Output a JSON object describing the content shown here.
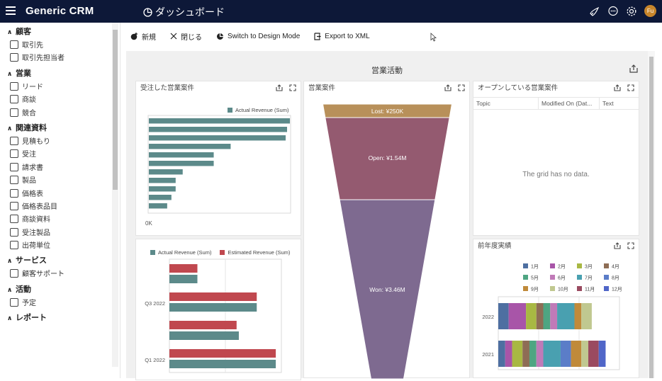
{
  "app": {
    "name": "Generic CRM",
    "page_title": "ダッシュボード",
    "avatar_initials": "Fu"
  },
  "sidebar": {
    "groups": [
      {
        "label": "顧客",
        "items": [
          "取引先",
          "取引先担当者"
        ]
      },
      {
        "label": "営業",
        "items": [
          "リード",
          "商談",
          "競合"
        ]
      },
      {
        "label": "関連資料",
        "items": [
          "見積もり",
          "受注",
          "請求書",
          "製品",
          "価格表",
          "価格表品目",
          "商談資料",
          "受注製品",
          "出荷単位"
        ]
      },
      {
        "label": "サービス",
        "items": [
          "顧客サポート"
        ]
      },
      {
        "label": "活動",
        "items": [
          "予定"
        ]
      },
      {
        "label": "レポート",
        "items": []
      }
    ]
  },
  "toolbar": {
    "new": "新規",
    "close": "閉じる",
    "design": "Switch to Design Mode",
    "export": "Export to XML"
  },
  "dashboard": {
    "title": "営業活動",
    "won_panel": {
      "title": "受注した営業案件",
      "legend": "Actual Revenue (Sum)",
      "axis_label": "0K"
    },
    "quarter_panel": {
      "legend_actual": "Actual Revenue (Sum)",
      "legend_estimated": "Estimated Revenue (Sum)",
      "tick_labels": [
        "Q3 2022",
        "Q1 2022"
      ]
    },
    "funnel_panel": {
      "title": "営業案件"
    },
    "open_panel": {
      "title": "オープンしている営業案件",
      "columns": [
        "Topic",
        "Modified On (Dat...",
        "Text"
      ],
      "empty_text": "The grid has no data."
    },
    "yearly_panel": {
      "title": "前年度実績"
    }
  },
  "colors": {
    "teal": "#5c8a8a",
    "red": "#c0484f",
    "funnel_lost": "#b8905a",
    "funnel_open": "#945a70",
    "funnel_won": "#7e6a90"
  },
  "chart_data": [
    {
      "type": "bar",
      "orientation": "horizontal",
      "title": "受注した営業案件",
      "series": [
        {
          "name": "Actual Revenue (Sum)",
          "values": [
            100,
            98,
            97,
            58,
            46,
            46,
            24,
            19,
            19,
            16,
            13
          ]
        }
      ],
      "xlim": [
        0,
        100
      ]
    },
    {
      "type": "bar",
      "orientation": "horizontal",
      "categories": [
        "",
        "Q3 2022",
        "",
        "Q1 2022"
      ],
      "series": [
        {
          "name": "Estimated Revenue (Sum)",
          "values": [
            25,
            78,
            60,
            95
          ]
        },
        {
          "name": "Actual Revenue (Sum)",
          "values": [
            25,
            78,
            62,
            95
          ]
        }
      ],
      "xlim": [
        0,
        100
      ]
    },
    {
      "type": "funnel",
      "title": "営業案件",
      "stages": [
        {
          "label": "Lost: ¥250K",
          "value": 250
        },
        {
          "label": "Open: ¥1.54M",
          "value": 1540
        },
        {
          "label": "Won: ¥3.46M",
          "value": 3460
        }
      ]
    },
    {
      "type": "bar",
      "orientation": "horizontal",
      "stacked": true,
      "title": "前年度実績",
      "categories": [
        "2022",
        "2021"
      ],
      "series": [
        {
          "name": "1月",
          "color": "#4e6fa1",
          "values": [
            3,
            2
          ]
        },
        {
          "name": "2月",
          "color": "#a855a8",
          "values": [
            5,
            2
          ]
        },
        {
          "name": "3月",
          "color": "#a8b843",
          "values": [
            3,
            3
          ]
        },
        {
          "name": "4月",
          "color": "#8e6d55",
          "values": [
            2,
            2
          ]
        },
        {
          "name": "5月",
          "color": "#4ea582",
          "values": [
            2,
            2
          ]
        },
        {
          "name": "6月",
          "color": "#c07ab8",
          "values": [
            2,
            2
          ]
        },
        {
          "name": "7月",
          "color": "#49a0b0",
          "values": [
            5,
            5
          ]
        },
        {
          "name": "8月",
          "color": "#5b7dc8",
          "values": [
            0,
            3
          ]
        },
        {
          "name": "9月",
          "color": "#c08a3a",
          "values": [
            2,
            3
          ]
        },
        {
          "name": "10月",
          "color": "#c0c890",
          "values": [
            3,
            2
          ]
        },
        {
          "name": "11月",
          "color": "#9a4a60",
          "values": [
            0,
            3
          ]
        },
        {
          "name": "12月",
          "color": "#5066c8",
          "values": [
            0,
            2
          ]
        }
      ],
      "xlim": [
        0,
        35
      ]
    }
  ]
}
